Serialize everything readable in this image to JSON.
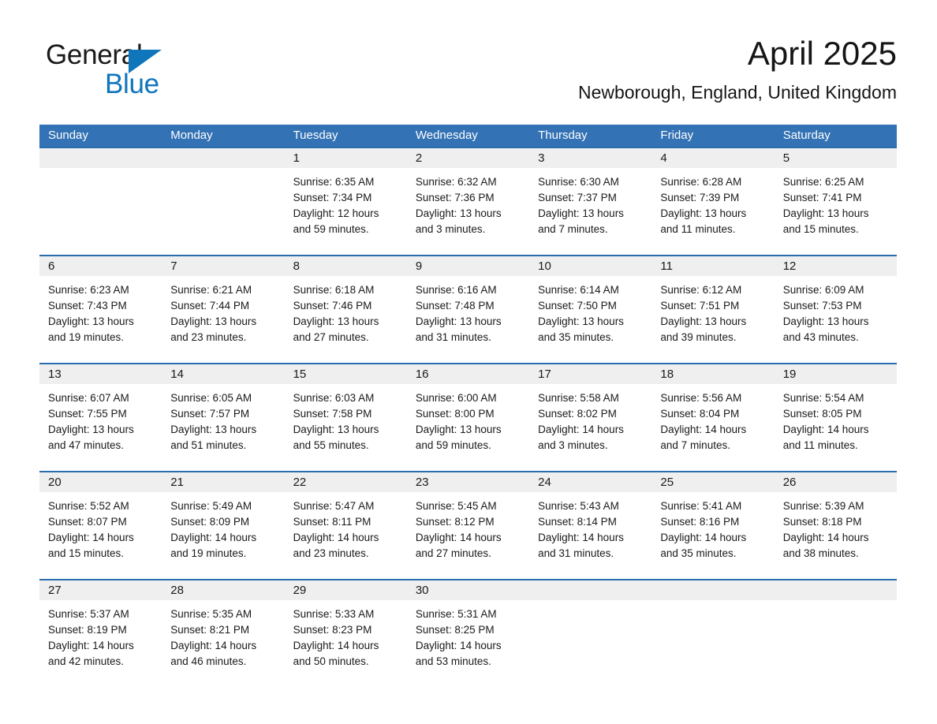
{
  "logo": {
    "word_one": "General",
    "word_two": "Blue",
    "triangle_icon": "triangle-icon",
    "accent_color": "#0f76bc"
  },
  "header": {
    "title": "April 2025",
    "subtitle": "Newborough, England, United Kingdom"
  },
  "colors": {
    "header_blue": "#3372b4",
    "row_divider_blue": "#2b6cad",
    "daynum_band_gray": "#efefef",
    "logo_blue": "#0f76bc",
    "text": "#1a1a1a"
  },
  "calendar": {
    "weekdays": [
      "Sunday",
      "Monday",
      "Tuesday",
      "Wednesday",
      "Thursday",
      "Friday",
      "Saturday"
    ],
    "weeks": [
      {
        "days": [
          {
            "num": "",
            "sunrise": "",
            "sunset": "",
            "daylight_1": "",
            "daylight_2": ""
          },
          {
            "num": "",
            "sunrise": "",
            "sunset": "",
            "daylight_1": "",
            "daylight_2": ""
          },
          {
            "num": "1",
            "sunrise": "Sunrise: 6:35 AM",
            "sunset": "Sunset: 7:34 PM",
            "daylight_1": "Daylight: 12 hours",
            "daylight_2": "and 59 minutes."
          },
          {
            "num": "2",
            "sunrise": "Sunrise: 6:32 AM",
            "sunset": "Sunset: 7:36 PM",
            "daylight_1": "Daylight: 13 hours",
            "daylight_2": "and 3 minutes."
          },
          {
            "num": "3",
            "sunrise": "Sunrise: 6:30 AM",
            "sunset": "Sunset: 7:37 PM",
            "daylight_1": "Daylight: 13 hours",
            "daylight_2": "and 7 minutes."
          },
          {
            "num": "4",
            "sunrise": "Sunrise: 6:28 AM",
            "sunset": "Sunset: 7:39 PM",
            "daylight_1": "Daylight: 13 hours",
            "daylight_2": "and 11 minutes."
          },
          {
            "num": "5",
            "sunrise": "Sunrise: 6:25 AM",
            "sunset": "Sunset: 7:41 PM",
            "daylight_1": "Daylight: 13 hours",
            "daylight_2": "and 15 minutes."
          }
        ]
      },
      {
        "days": [
          {
            "num": "6",
            "sunrise": "Sunrise: 6:23 AM",
            "sunset": "Sunset: 7:43 PM",
            "daylight_1": "Daylight: 13 hours",
            "daylight_2": "and 19 minutes."
          },
          {
            "num": "7",
            "sunrise": "Sunrise: 6:21 AM",
            "sunset": "Sunset: 7:44 PM",
            "daylight_1": "Daylight: 13 hours",
            "daylight_2": "and 23 minutes."
          },
          {
            "num": "8",
            "sunrise": "Sunrise: 6:18 AM",
            "sunset": "Sunset: 7:46 PM",
            "daylight_1": "Daylight: 13 hours",
            "daylight_2": "and 27 minutes."
          },
          {
            "num": "9",
            "sunrise": "Sunrise: 6:16 AM",
            "sunset": "Sunset: 7:48 PM",
            "daylight_1": "Daylight: 13 hours",
            "daylight_2": "and 31 minutes."
          },
          {
            "num": "10",
            "sunrise": "Sunrise: 6:14 AM",
            "sunset": "Sunset: 7:50 PM",
            "daylight_1": "Daylight: 13 hours",
            "daylight_2": "and 35 minutes."
          },
          {
            "num": "11",
            "sunrise": "Sunrise: 6:12 AM",
            "sunset": "Sunset: 7:51 PM",
            "daylight_1": "Daylight: 13 hours",
            "daylight_2": "and 39 minutes."
          },
          {
            "num": "12",
            "sunrise": "Sunrise: 6:09 AM",
            "sunset": "Sunset: 7:53 PM",
            "daylight_1": "Daylight: 13 hours",
            "daylight_2": "and 43 minutes."
          }
        ]
      },
      {
        "days": [
          {
            "num": "13",
            "sunrise": "Sunrise: 6:07 AM",
            "sunset": "Sunset: 7:55 PM",
            "daylight_1": "Daylight: 13 hours",
            "daylight_2": "and 47 minutes."
          },
          {
            "num": "14",
            "sunrise": "Sunrise: 6:05 AM",
            "sunset": "Sunset: 7:57 PM",
            "daylight_1": "Daylight: 13 hours",
            "daylight_2": "and 51 minutes."
          },
          {
            "num": "15",
            "sunrise": "Sunrise: 6:03 AM",
            "sunset": "Sunset: 7:58 PM",
            "daylight_1": "Daylight: 13 hours",
            "daylight_2": "and 55 minutes."
          },
          {
            "num": "16",
            "sunrise": "Sunrise: 6:00 AM",
            "sunset": "Sunset: 8:00 PM",
            "daylight_1": "Daylight: 13 hours",
            "daylight_2": "and 59 minutes."
          },
          {
            "num": "17",
            "sunrise": "Sunrise: 5:58 AM",
            "sunset": "Sunset: 8:02 PM",
            "daylight_1": "Daylight: 14 hours",
            "daylight_2": "and 3 minutes."
          },
          {
            "num": "18",
            "sunrise": "Sunrise: 5:56 AM",
            "sunset": "Sunset: 8:04 PM",
            "daylight_1": "Daylight: 14 hours",
            "daylight_2": "and 7 minutes."
          },
          {
            "num": "19",
            "sunrise": "Sunrise: 5:54 AM",
            "sunset": "Sunset: 8:05 PM",
            "daylight_1": "Daylight: 14 hours",
            "daylight_2": "and 11 minutes."
          }
        ]
      },
      {
        "days": [
          {
            "num": "20",
            "sunrise": "Sunrise: 5:52 AM",
            "sunset": "Sunset: 8:07 PM",
            "daylight_1": "Daylight: 14 hours",
            "daylight_2": "and 15 minutes."
          },
          {
            "num": "21",
            "sunrise": "Sunrise: 5:49 AM",
            "sunset": "Sunset: 8:09 PM",
            "daylight_1": "Daylight: 14 hours",
            "daylight_2": "and 19 minutes."
          },
          {
            "num": "22",
            "sunrise": "Sunrise: 5:47 AM",
            "sunset": "Sunset: 8:11 PM",
            "daylight_1": "Daylight: 14 hours",
            "daylight_2": "and 23 minutes."
          },
          {
            "num": "23",
            "sunrise": "Sunrise: 5:45 AM",
            "sunset": "Sunset: 8:12 PM",
            "daylight_1": "Daylight: 14 hours",
            "daylight_2": "and 27 minutes."
          },
          {
            "num": "24",
            "sunrise": "Sunrise: 5:43 AM",
            "sunset": "Sunset: 8:14 PM",
            "daylight_1": "Daylight: 14 hours",
            "daylight_2": "and 31 minutes."
          },
          {
            "num": "25",
            "sunrise": "Sunrise: 5:41 AM",
            "sunset": "Sunset: 8:16 PM",
            "daylight_1": "Daylight: 14 hours",
            "daylight_2": "and 35 minutes."
          },
          {
            "num": "26",
            "sunrise": "Sunrise: 5:39 AM",
            "sunset": "Sunset: 8:18 PM",
            "daylight_1": "Daylight: 14 hours",
            "daylight_2": "and 38 minutes."
          }
        ]
      },
      {
        "days": [
          {
            "num": "27",
            "sunrise": "Sunrise: 5:37 AM",
            "sunset": "Sunset: 8:19 PM",
            "daylight_1": "Daylight: 14 hours",
            "daylight_2": "and 42 minutes."
          },
          {
            "num": "28",
            "sunrise": "Sunrise: 5:35 AM",
            "sunset": "Sunset: 8:21 PM",
            "daylight_1": "Daylight: 14 hours",
            "daylight_2": "and 46 minutes."
          },
          {
            "num": "29",
            "sunrise": "Sunrise: 5:33 AM",
            "sunset": "Sunset: 8:23 PM",
            "daylight_1": "Daylight: 14 hours",
            "daylight_2": "and 50 minutes."
          },
          {
            "num": "30",
            "sunrise": "Sunrise: 5:31 AM",
            "sunset": "Sunset: 8:25 PM",
            "daylight_1": "Daylight: 14 hours",
            "daylight_2": "and 53 minutes."
          },
          {
            "num": "",
            "sunrise": "",
            "sunset": "",
            "daylight_1": "",
            "daylight_2": ""
          },
          {
            "num": "",
            "sunrise": "",
            "sunset": "",
            "daylight_1": "",
            "daylight_2": ""
          },
          {
            "num": "",
            "sunrise": "",
            "sunset": "",
            "daylight_1": "",
            "daylight_2": ""
          }
        ]
      }
    ]
  }
}
